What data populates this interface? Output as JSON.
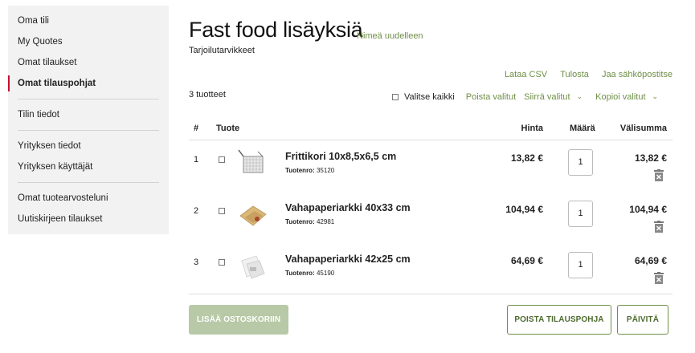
{
  "sidebar": {
    "items": [
      {
        "label": "Oma tili"
      },
      {
        "label": "My Quotes"
      },
      {
        "label": "Omat tilaukset"
      },
      {
        "label": "Omat tilauspohjat"
      },
      {
        "label": "Tilin tiedot"
      },
      {
        "label": "Yrityksen tiedot"
      },
      {
        "label": "Yrityksen käyttäjät"
      },
      {
        "label": "Omat tuotearvosteluni"
      },
      {
        "label": "Uutiskirjeen tilaukset"
      }
    ],
    "active_index": 3
  },
  "page": {
    "title": "Fast food lisäyksiä",
    "rename_link": "Nimeä uudelleen",
    "subtitle": "Tarjoilutarvikkeet"
  },
  "top_links": {
    "csv": "Lataa CSV",
    "print": "Tulosta",
    "email": "Jaa sähköpostitse"
  },
  "list": {
    "count_label": "3 tuotteet",
    "select_all": "Valitse kaikki",
    "remove_selected": "Poista valitut",
    "move_selected": "Siirrä valitut",
    "copy_selected": "Kopioi valitut"
  },
  "table": {
    "headers": {
      "num": "#",
      "product": "Tuote",
      "price": "Hinta",
      "qty": "Määrä",
      "subtotal": "Välisumma"
    },
    "code_label": "Tuotenro:",
    "rows": [
      {
        "num": "1",
        "name": "Frittikori 10x8,5x6,5 cm",
        "code": "35120",
        "price": "13,82 €",
        "qty": "1",
        "subtotal": "13,82 €",
        "thumb": "fryer-basket-icon"
      },
      {
        "num": "2",
        "name": "Vahapaperiarkki 40x33 cm",
        "code": "42981",
        "price": "104,94 €",
        "qty": "1",
        "subtotal": "104,94 €",
        "thumb": "wax-paper-brown-icon"
      },
      {
        "num": "3",
        "name": "Vahapaperiarkki 42x25 cm",
        "code": "45190",
        "price": "64,69 €",
        "qty": "1",
        "subtotal": "64,69 €",
        "thumb": "wax-paper-white-icon"
      }
    ]
  },
  "buttons": {
    "add_to_cart": "LISÄÄ OSTOSKORIIN",
    "delete_template": "POISTA TILAUSPOHJA",
    "update": "PÄIVITÄ"
  },
  "colors": {
    "accent_green": "#6f8f47",
    "active_marker": "#c8102e",
    "disabled_button": "#b7c9a6"
  }
}
